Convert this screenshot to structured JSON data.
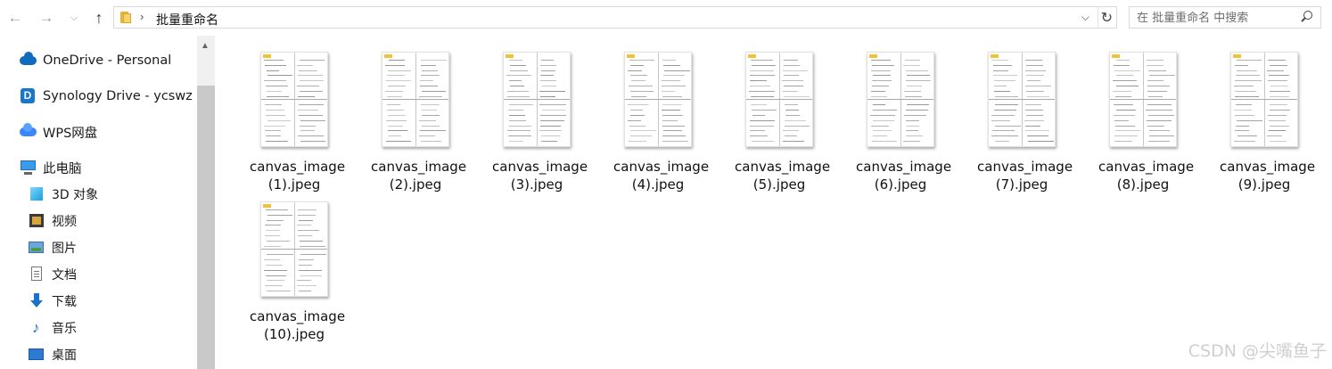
{
  "toolbar": {
    "back_icon": "arrow-left-icon",
    "forward_icon": "arrow-right-icon",
    "recent_icon": "chevron-down-icon",
    "up_icon": "arrow-up-icon"
  },
  "address": {
    "separator": "›",
    "path": "批量重命名",
    "dropdown": "⌵",
    "refresh": "↻"
  },
  "search": {
    "placeholder": "在 批量重命名 中搜索"
  },
  "sidebar": {
    "items": [
      {
        "label": "OneDrive - Personal",
        "icon": "onedrive-cloud-icon"
      },
      {
        "label": "Synology Drive - ycswz",
        "icon": "synology-drive-icon"
      },
      {
        "label": "WPS网盘",
        "icon": "wps-cloud-icon"
      },
      {
        "label": "此电脑",
        "icon": "this-pc-icon"
      },
      {
        "label": "3D 对象",
        "icon": "3d-objects-icon"
      },
      {
        "label": "视频",
        "icon": "videos-icon"
      },
      {
        "label": "图片",
        "icon": "pictures-icon"
      },
      {
        "label": "文档",
        "icon": "documents-icon"
      },
      {
        "label": "下载",
        "icon": "downloads-icon"
      },
      {
        "label": "音乐",
        "icon": "music-icon"
      },
      {
        "label": "桌面",
        "icon": "desktop-icon"
      }
    ]
  },
  "files": [
    {
      "line1": "canvas_image",
      "line2": "(1).jpeg"
    },
    {
      "line1": "canvas_image",
      "line2": "(2).jpeg"
    },
    {
      "line1": "canvas_image",
      "line2": "(3).jpeg"
    },
    {
      "line1": "canvas_image",
      "line2": "(4).jpeg"
    },
    {
      "line1": "canvas_image",
      "line2": "(5).jpeg"
    },
    {
      "line1": "canvas_image",
      "line2": "(6).jpeg"
    },
    {
      "line1": "canvas_image",
      "line2": "(7).jpeg"
    },
    {
      "line1": "canvas_image",
      "line2": "(8).jpeg"
    },
    {
      "line1": "canvas_image",
      "line2": "(9).jpeg"
    },
    {
      "line1": "canvas_image",
      "line2": "(10).jpeg"
    }
  ],
  "watermark": "CSDN @尖嘴鱼子",
  "colors": {
    "accent": "#0f6cbd",
    "folder": "#f6d36b",
    "thumb_tag": "#f2c230"
  }
}
